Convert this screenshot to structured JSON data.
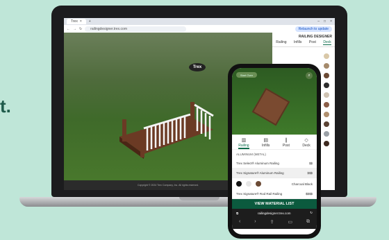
{
  "tagline": {
    "text": "t."
  },
  "browser": {
    "tab_title": "Trex",
    "url": "railingdesigner.trex.com",
    "update_label": "Relaunch to update"
  },
  "panel": {
    "title": "RAILING DESIGNER",
    "tabs": [
      "Railing",
      "Infills",
      "Post",
      "Deck"
    ],
    "active_tab": "Deck",
    "swatch_colors": [
      "#d9c8a8",
      "#a58a6c",
      "#6b4a35",
      "#2d2d2d",
      "#cfc3b3",
      "#8b5e48",
      "#b0906f",
      "#5b4334",
      "#9aa0a6",
      "#3e2a20"
    ]
  },
  "scene": {
    "logo": "Trex",
    "footer": "Copyright © 2024 Trex Company, Inc. All rights reserved."
  },
  "phone": {
    "pill_label": "Start Over",
    "tabs": [
      {
        "label": "Railing",
        "icon": "railing-icon"
      },
      {
        "label": "Infills",
        "icon": "infills-icon"
      },
      {
        "label": "Post",
        "icon": "post-icon"
      },
      {
        "label": "Deck",
        "icon": "deck-icon"
      }
    ],
    "section_title": "ALUMINUM (METAL)",
    "rows": [
      {
        "name": "Trex Select® Aluminum Railing",
        "price": "$$"
      },
      {
        "name": "Trex Signature® Aluminum Railing",
        "price": "$$$"
      }
    ],
    "swatch_label": "Charcoal Black",
    "swatch_colors": [
      "#111111",
      "#e6e6e6",
      "#6b4a35"
    ],
    "row3": {
      "name": "Trex Signature® Rod Rail Railing",
      "price": "$$$$"
    },
    "cta": "VIEW MATERIAL LIST",
    "address": "railingdesigner.trex.com"
  },
  "colors": {
    "accent": "#0b5a3e",
    "background": "#bfe6d8"
  }
}
